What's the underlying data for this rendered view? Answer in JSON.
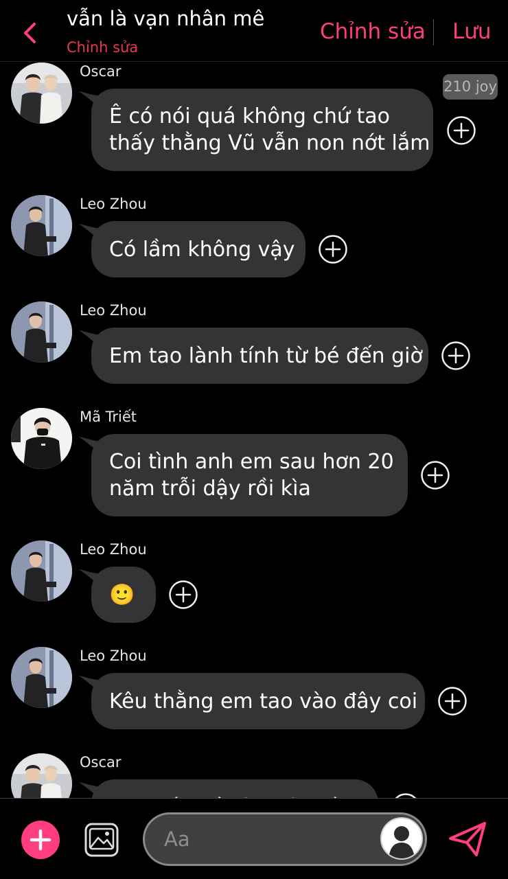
{
  "header": {
    "title": "vẫn là vạn nhân mê",
    "subtitle": "Chỉnh sửa",
    "edit_label": "Chỉnh sửa",
    "save_label": "Lưu",
    "back_icon": "chevron-left-icon",
    "accent_color": "#ff3d7f"
  },
  "messages": [
    {
      "sender": "Oscar",
      "avatar": "oscar-avatar",
      "lines": [
        "Ê có nói quá không chứ tao",
        "thấy thằng Vũ vẫn non nớt lắm"
      ],
      "badge": "210 joy"
    },
    {
      "sender": "Leo Zhou",
      "avatar": "leo-avatar",
      "lines": [
        "Có lầm không vậy"
      ]
    },
    {
      "sender": "Leo Zhou",
      "avatar": "leo-avatar",
      "lines": [
        "Em tao lành tính từ bé đến giờ"
      ]
    },
    {
      "sender": "Mã Triết",
      "avatar": "ma-triet-avatar",
      "lines": [
        "Coi tình anh em sau hơn 20",
        "năm trỗi dậy rồi kìa"
      ]
    },
    {
      "sender": "Leo Zhou",
      "avatar": "leo-avatar",
      "lines": [
        "🙂"
      ]
    },
    {
      "sender": "Leo Zhou",
      "avatar": "leo-avatar",
      "lines": [
        "Kêu thằng em tao vào đây coi"
      ]
    },
    {
      "sender": "Oscar",
      "avatar": "oscar-avatar",
      "lines": [
        "Tạo vấn đề vào đây rồi"
      ]
    }
  ],
  "composer": {
    "placeholder": "Aa",
    "plus_icon": "plus-icon",
    "gallery_icon": "image-icon",
    "send_icon": "send-icon"
  }
}
